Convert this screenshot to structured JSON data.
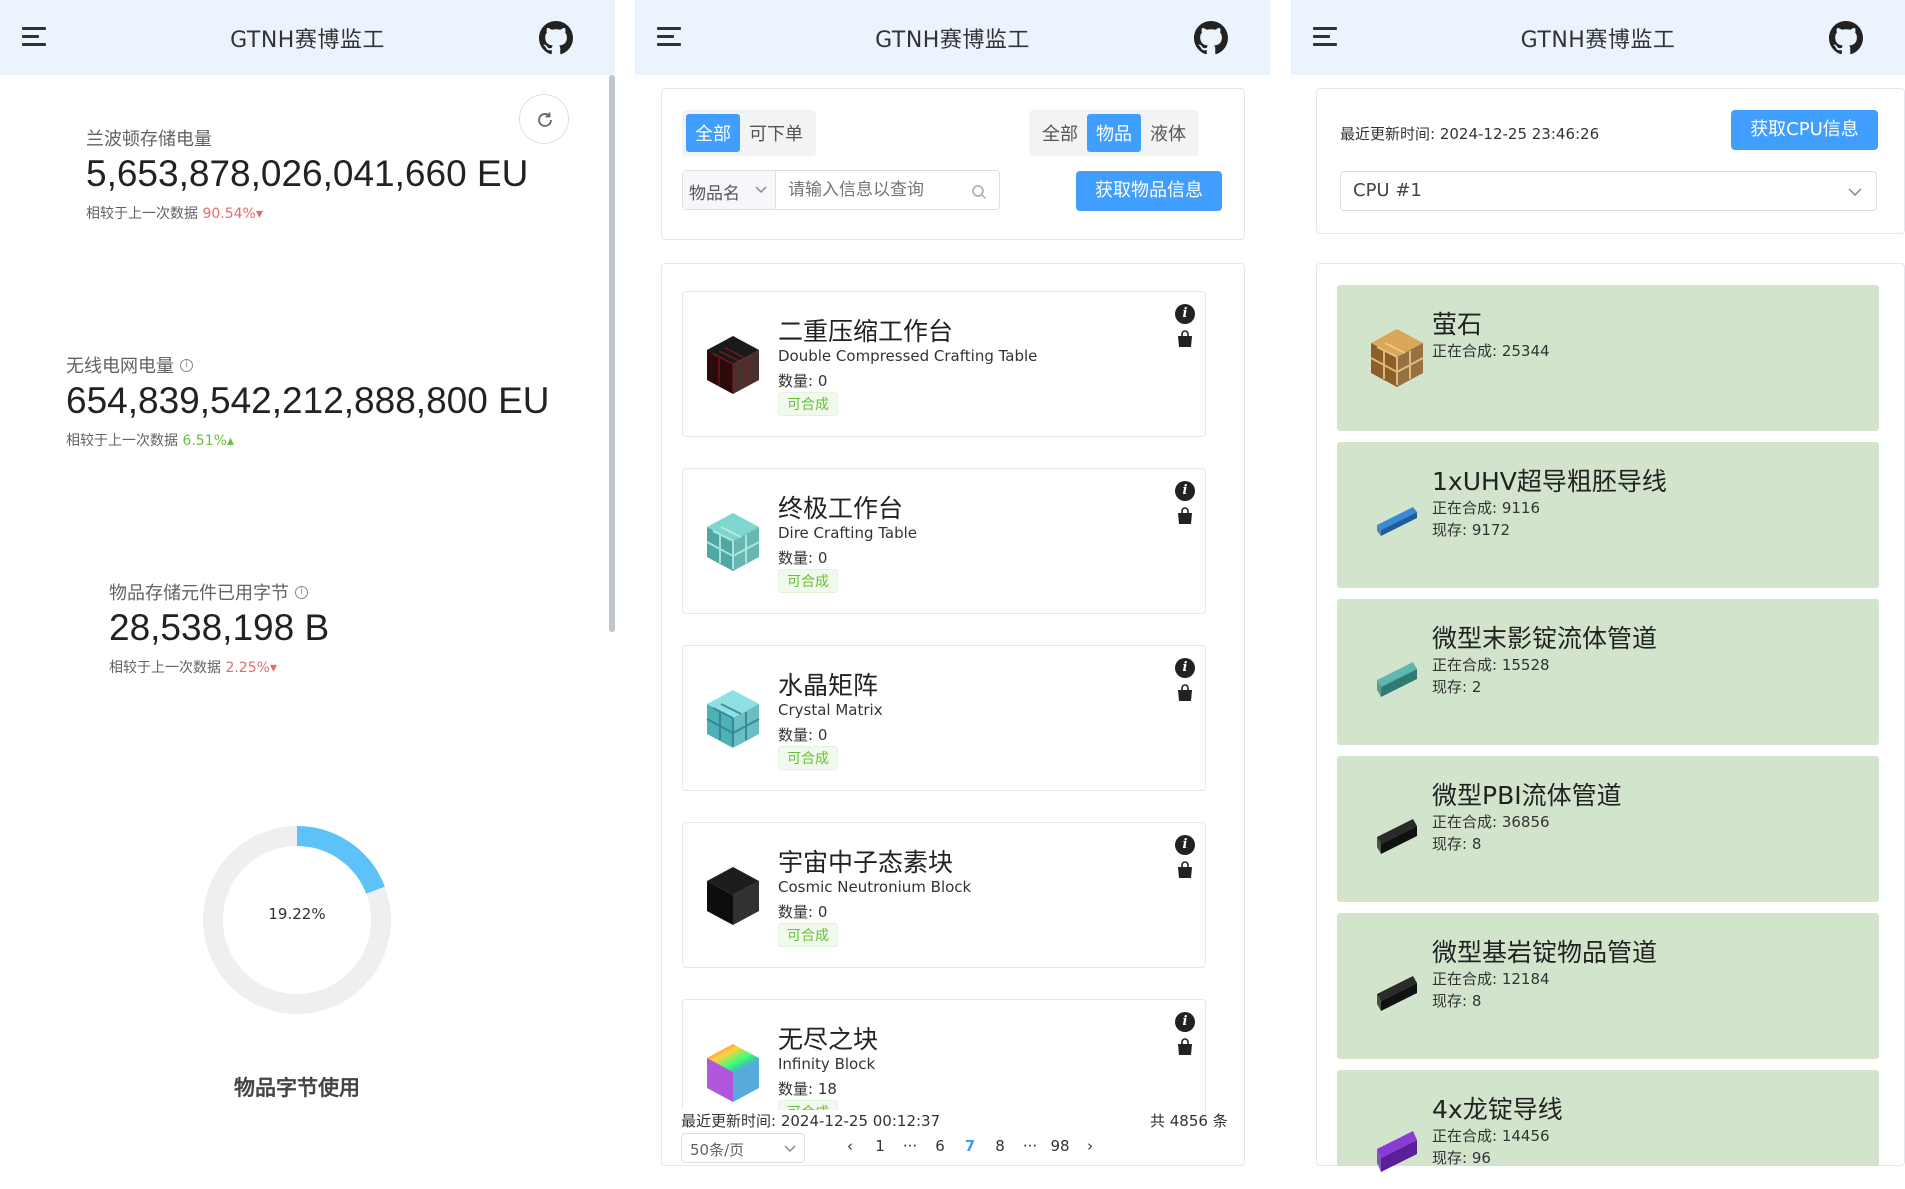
{
  "app": {
    "title": "GTNH赛博监工"
  },
  "energy": {
    "lapotron": {
      "label": "兰波顿存储电量",
      "value": "5,653,878,026,041,660 EU",
      "compare_label": "相较于上一次数据",
      "compare_value": "90.54%",
      "trend": "down"
    },
    "wireless": {
      "label": "无线电网电量",
      "value": "654,839,542,212,888,800 EU",
      "compare_label": "相较于上一次数据",
      "compare_value": "6.51%",
      "trend": "up"
    },
    "item_storage": {
      "label": "物品存储元件已用字节",
      "value": "28,538,198 B",
      "compare_label": "相较于上一次数据",
      "compare_value": "2.25%",
      "trend": "down"
    }
  },
  "usage_chart": {
    "percent_label": "19.22%",
    "percent": 19.22,
    "title": "物品字节使用",
    "color_used": "#5cc2f7",
    "color_rest": "#efefef"
  },
  "items_panel": {
    "filter_left": [
      "全部",
      "可下单"
    ],
    "filter_left_active": 0,
    "filter_right": [
      "全部",
      "物品",
      "液体"
    ],
    "filter_right_active": 1,
    "search_type": "物品名",
    "search_placeholder": "请输入信息以查询",
    "fetch_button": "获取物品信息",
    "qty_prefix": "数量: ",
    "items": [
      {
        "cn": "二重压缩工作台",
        "en": "Double Compressed Crafting Table",
        "qty": "数量: 0",
        "tag": "可合成",
        "icon": "dark-crafting-block-icon"
      },
      {
        "cn": "终极工作台",
        "en": "Dire Crafting Table",
        "qty": "数量: 0",
        "tag": "可合成",
        "icon": "dire-crafting-block-icon"
      },
      {
        "cn": "水晶矩阵",
        "en": "Crystal Matrix",
        "qty": "数量: 0",
        "tag": "可合成",
        "icon": "crystal-matrix-block-icon"
      },
      {
        "cn": "宇宙中子态素块",
        "en": "Cosmic Neutronium Block",
        "qty": "数量: 0",
        "tag": "可合成",
        "icon": "neutronium-block-icon"
      },
      {
        "cn": "无尽之块",
        "en": "Infinity Block",
        "qty": "数量: 18",
        "tag": "可合成",
        "icon": "infinity-block-icon"
      }
    ],
    "updated": "最近更新时间: 2024-12-25 00:12:37",
    "total": "共 4856 条",
    "page_size": "50条/页",
    "pages": [
      "1",
      "···",
      "6",
      "7",
      "8",
      "···",
      "98"
    ],
    "current_page": "7"
  },
  "cpu_panel": {
    "updated": "最近更新时间: 2024-12-25 23:46:26",
    "fetch_button": "获取CPU信息",
    "cpu_selected": "CPU #1",
    "jobs": [
      {
        "name": "萤石",
        "crafting": "正在合成: 25344",
        "stock": "",
        "icon": "glowstone-block-icon"
      },
      {
        "name": "1xUHV超导粗胚导线",
        "crafting": "正在合成: 9116",
        "stock": "现存: 9172",
        "icon": "blue-wire-icon"
      },
      {
        "name": "微型末影锭流体管道",
        "crafting": "正在合成: 15528",
        "stock": "现存: 2",
        "icon": "teal-pipe-icon"
      },
      {
        "name": "微型PBI流体管道",
        "crafting": "正在合成: 36856",
        "stock": "现存: 8",
        "icon": "black-pipe-icon"
      },
      {
        "name": "微型基岩锭物品管道",
        "crafting": "正在合成: 12184",
        "stock": "现存: 8",
        "icon": "black-pipe-icon"
      },
      {
        "name": "4x龙锭导线",
        "crafting": "正在合成: 14456",
        "stock": "现存: 96",
        "icon": "purple-wire-icon"
      }
    ]
  },
  "colors": {
    "header_bg": "#ebf3fd",
    "primary": "#409eff",
    "success": "#67c23a",
    "danger": "#e06c6c",
    "job_bg": "#d3e4cd"
  }
}
